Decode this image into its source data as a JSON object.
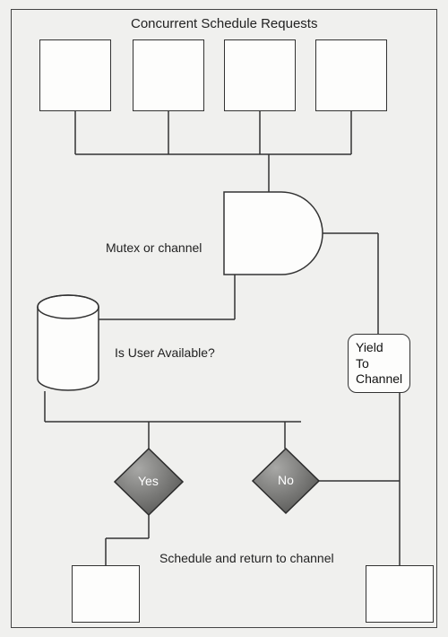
{
  "title": "Concurrent Schedule Requests",
  "labels": {
    "mutex": "Mutex or channel",
    "available": "Is User Available?",
    "yes": "Yes",
    "no": "No",
    "yield_line1": "Yield",
    "yield_line2": "To",
    "yield_line3": "Channel",
    "schedule_return": "Schedule and return to channel"
  }
}
